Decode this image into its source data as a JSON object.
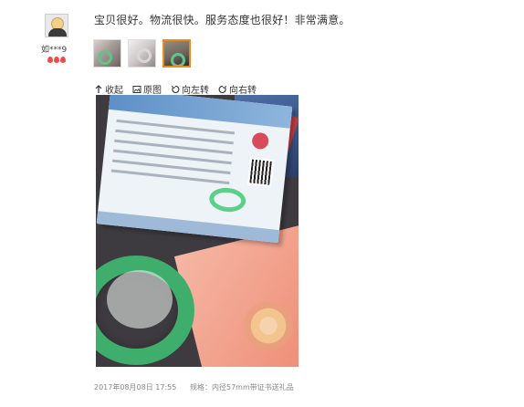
{
  "user": {
    "name": "如***9",
    "level_badge": "level-hearts-icon"
  },
  "review": {
    "text": "宝贝很好。物流很快。服务态度也很好！非常满意。"
  },
  "images": {
    "thumbnails": [
      {
        "label": "thumbnail-1",
        "active": false
      },
      {
        "label": "thumbnail-2",
        "active": false
      },
      {
        "label": "thumbnail-3",
        "active": true
      }
    ]
  },
  "toolbar": {
    "collapse_label": "收起",
    "original_label": "原图",
    "rotate_left_label": "向左转",
    "rotate_right_label": "向右转"
  },
  "footer": {
    "timestamp": "2017年08月08日 17:55",
    "spec": "规格：内径57mm带证书送礼品"
  },
  "colors": {
    "active_thumb_border": "#e88c1e",
    "badge": "#ef4a4a"
  }
}
